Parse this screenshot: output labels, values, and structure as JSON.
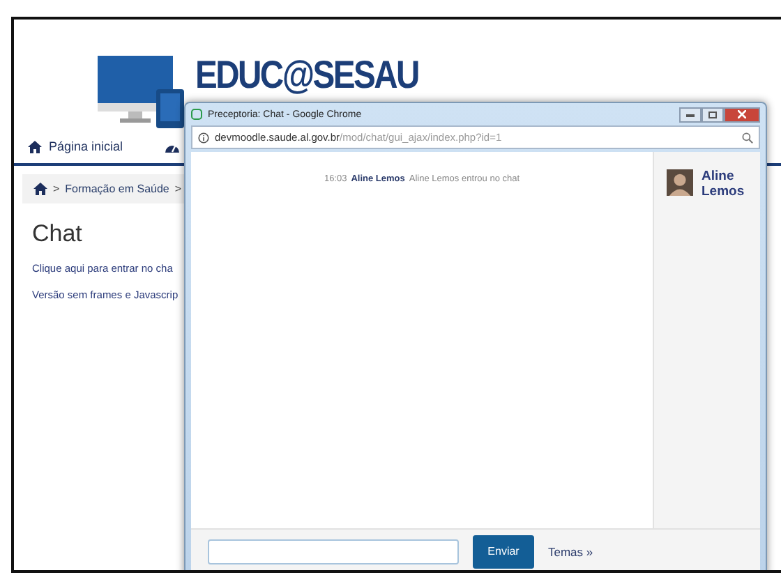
{
  "site": {
    "logo_text": "EDUC@SESAU",
    "nav": [
      {
        "label": "Página inicial",
        "kind": "home"
      },
      {
        "kind": "dashboard"
      }
    ],
    "breadcrumb_separator": ">",
    "breadcrumb": [
      "Formação em Saúde"
    ],
    "heading": "Chat",
    "links": [
      "Clique aqui para entrar no cha",
      "Versão sem frames e Javascrip"
    ]
  },
  "popup": {
    "title": "Preceptoria: Chat - Google Chrome",
    "url_host": "devmoodle.saude.al.gov.br",
    "url_path": "/mod/chat/gui_ajax/index.php?id=1",
    "messages": [
      {
        "time": "16:03",
        "user": "Aline Lemos",
        "text": "Aline Lemos entrou no chat"
      }
    ],
    "users": [
      {
        "name": "Aline Lemos"
      }
    ],
    "send_button": "Enviar",
    "themes_link": "Temas »"
  }
}
